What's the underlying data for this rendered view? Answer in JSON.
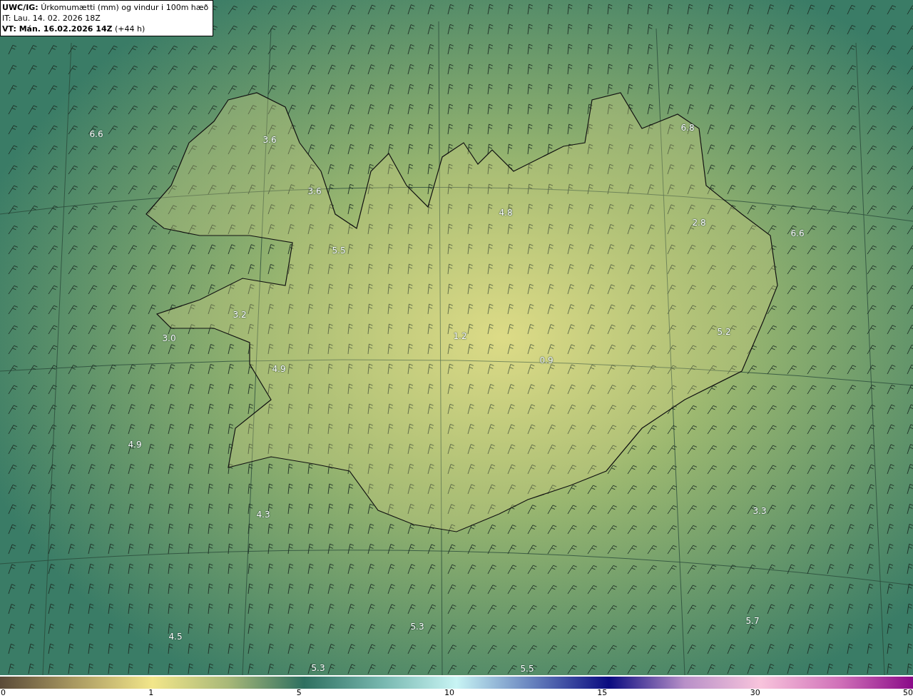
{
  "header": {
    "title": "**UWC/IG:** Úrkomumætti (mm) og vindur i 100m hæð",
    "issue_time": "IT: Lau. 14. 02. 2026 18Z",
    "valid_time": "**VT: Mán. 16.02.2026 14Z** (+44 h)"
  },
  "map_values": [
    "6.6",
    "3.6",
    "3.6",
    "4.8",
    "6.8",
    "2.8",
    "6.6",
    "5.5",
    "3.2",
    "3.0",
    "1.2",
    "0.9",
    "5.2",
    "4.9",
    "4.9",
    "4.3",
    "3.3",
    "5.3",
    "5.7",
    "4.5",
    "5.3",
    "5.5"
  ],
  "colorbar": {
    "ticks": [
      "0",
      "1",
      "5",
      "10",
      "15",
      "30",
      "50"
    ]
  }
}
